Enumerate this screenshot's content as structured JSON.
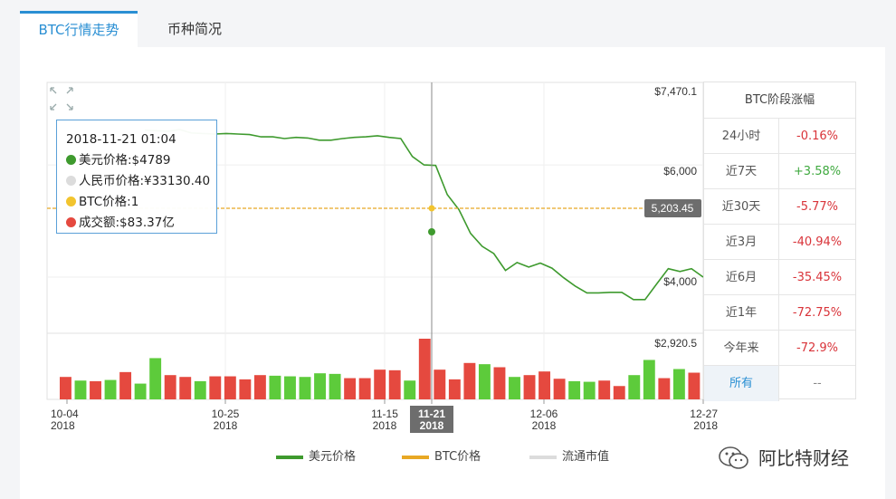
{
  "tabs": [
    {
      "label": "BTC行情走势",
      "active": true
    },
    {
      "label": "币种简况",
      "active": false
    }
  ],
  "chart_data": {
    "type": "line",
    "price_axis_labels": [
      "$7,470.1",
      "$6,000",
      "$4,000"
    ],
    "volume_axis_label": "$2,920.5",
    "current_price_marker": "5,203.45",
    "x_ticks": [
      {
        "date": "10-04",
        "year": "2018"
      },
      {
        "date": "10-25",
        "year": "2018"
      },
      {
        "date": "11-15",
        "year": "2018"
      },
      {
        "date": "11-21",
        "year": "2018",
        "highlight": true
      },
      {
        "date": "12-06",
        "year": "2018"
      },
      {
        "date": "12-27",
        "year": "2018"
      }
    ],
    "series": [
      {
        "name": "美元价格",
        "color": "#3e9a2e",
        "values": [
          6620,
          6610,
          6600,
          6630,
          6570,
          6560,
          6550,
          6560,
          6550,
          6540,
          6500,
          6500,
          6470,
          6490,
          6480,
          6440,
          6440,
          6470,
          6490,
          6500,
          6520,
          6490,
          6470,
          6150,
          6000,
          5990,
          5470,
          5203.45,
          4780,
          4550,
          4420,
          4120,
          4260,
          4180,
          4250,
          4160,
          3990,
          3840,
          3720,
          3720,
          3730,
          3730,
          3600,
          3600,
          3880,
          4150,
          4100,
          4150,
          4000
        ]
      },
      {
        "name": "BTC价格",
        "color": "#e8a824",
        "values": []
      },
      {
        "name": "流通市值",
        "color": "#dcdcdc",
        "values": []
      }
    ],
    "volume": {
      "color_up": "#5dcb3b",
      "color_down": "#e5493f",
      "values": [
        {
          "v": 0.37,
          "up": false
        },
        {
          "v": 0.31,
          "up": true
        },
        {
          "v": 0.3,
          "up": false
        },
        {
          "v": 0.32,
          "up": true
        },
        {
          "v": 0.45,
          "up": false
        },
        {
          "v": 0.26,
          "up": true
        },
        {
          "v": 0.68,
          "up": true
        },
        {
          "v": 0.4,
          "up": false
        },
        {
          "v": 0.37,
          "up": false
        },
        {
          "v": 0.3,
          "up": true
        },
        {
          "v": 0.38,
          "up": false
        },
        {
          "v": 0.38,
          "up": false
        },
        {
          "v": 0.33,
          "up": false
        },
        {
          "v": 0.4,
          "up": false
        },
        {
          "v": 0.39,
          "up": true
        },
        {
          "v": 0.38,
          "up": true
        },
        {
          "v": 0.37,
          "up": true
        },
        {
          "v": 0.43,
          "up": true
        },
        {
          "v": 0.42,
          "up": true
        },
        {
          "v": 0.35,
          "up": false
        },
        {
          "v": 0.35,
          "up": false
        },
        {
          "v": 0.49,
          "up": false
        },
        {
          "v": 0.48,
          "up": false
        },
        {
          "v": 0.31,
          "up": true
        },
        {
          "v": 1.0,
          "up": false
        },
        {
          "v": 0.49,
          "up": false
        },
        {
          "v": 0.33,
          "up": false
        },
        {
          "v": 0.6,
          "up": false
        },
        {
          "v": 0.58,
          "up": true
        },
        {
          "v": 0.53,
          "up": false
        },
        {
          "v": 0.37,
          "up": true
        },
        {
          "v": 0.4,
          "up": false
        },
        {
          "v": 0.46,
          "up": false
        },
        {
          "v": 0.34,
          "up": false
        },
        {
          "v": 0.3,
          "up": true
        },
        {
          "v": 0.29,
          "up": true
        },
        {
          "v": 0.31,
          "up": false
        },
        {
          "v": 0.22,
          "up": false
        },
        {
          "v": 0.4,
          "up": true
        },
        {
          "v": 0.65,
          "up": true
        },
        {
          "v": 0.35,
          "up": false
        },
        {
          "v": 0.5,
          "up": true
        },
        {
          "v": 0.44,
          "up": false
        }
      ]
    },
    "ylim": [
      3000,
      7470.1
    ]
  },
  "tooltip": {
    "time": "2018-11-21 01:04",
    "usd": "美元价格:$4789",
    "cny": "人民币价格:¥33130.40",
    "btc": "BTC价格:1",
    "volume": "成交额:$83.37亿",
    "colors": {
      "usd": "#3e9a2e",
      "cny": "#dcdcdc",
      "btc": "#f2c42e",
      "volume": "#e5493f"
    }
  },
  "stats": {
    "title": "BTC阶段涨幅",
    "rows": [
      {
        "label": "24小时",
        "value": "-0.16%",
        "positive": false
      },
      {
        "label": "近7天",
        "value": "+3.58%",
        "positive": true
      },
      {
        "label": "近30天",
        "value": "-5.77%",
        "positive": false
      },
      {
        "label": "近3月",
        "value": "-40.94%",
        "positive": false
      },
      {
        "label": "近6月",
        "value": "-35.45%",
        "positive": false
      },
      {
        "label": "近1年",
        "value": "-72.75%",
        "positive": false
      },
      {
        "label": "今年来",
        "value": "-72.9%",
        "positive": false
      }
    ],
    "all_label": "所有",
    "all_value": "--"
  },
  "legend": [
    {
      "label": "美元价格",
      "color": "#3e9a2e"
    },
    {
      "label": "BTC价格",
      "color": "#e8a824"
    },
    {
      "label": "流通市值",
      "color": "#dcdcdc"
    }
  ],
  "watermark": "阿比特财经"
}
